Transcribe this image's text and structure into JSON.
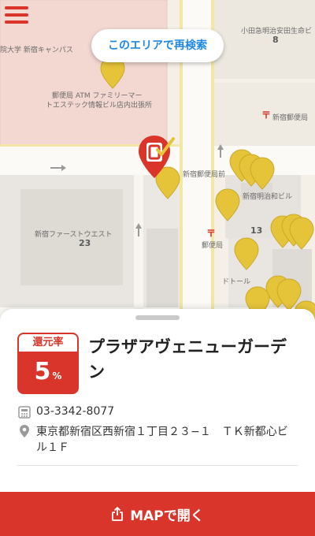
{
  "map": {
    "search_button": "このエリアで再検索",
    "labels": {
      "campus": "院大学 新宿キャンパス",
      "post_atm_1": "郵便局 ATM ファミリーマー",
      "post_atm_2": "トエステック情報ビル店内出張所",
      "odakyu": "小田急明治安田生命ビ",
      "odakyu_num": "8",
      "shinjuku_post": "新宿郵便局",
      "bus_stop": "新宿郵便局前",
      "meiji": "新宿明治和ビル",
      "first_west": "新宿ファーストウエスト",
      "first_west_num": "23",
      "post_office": "郵便局",
      "block_13": "13",
      "dotour": "ドトール"
    }
  },
  "shop": {
    "rate_label": "還元率",
    "rate_value": "5",
    "rate_unit": "%",
    "name": "プラザアヴェニューガーデン",
    "phone": "03-3342-8077",
    "address": "東京都新宿区西新宿１丁目２３−１　ＴＫ新都心ビル１Ｆ"
  },
  "action": {
    "open_map": "MAPで開く"
  },
  "colors": {
    "accent": "#d9352b",
    "pin": "#e6c43a",
    "link": "#1e88e5"
  }
}
